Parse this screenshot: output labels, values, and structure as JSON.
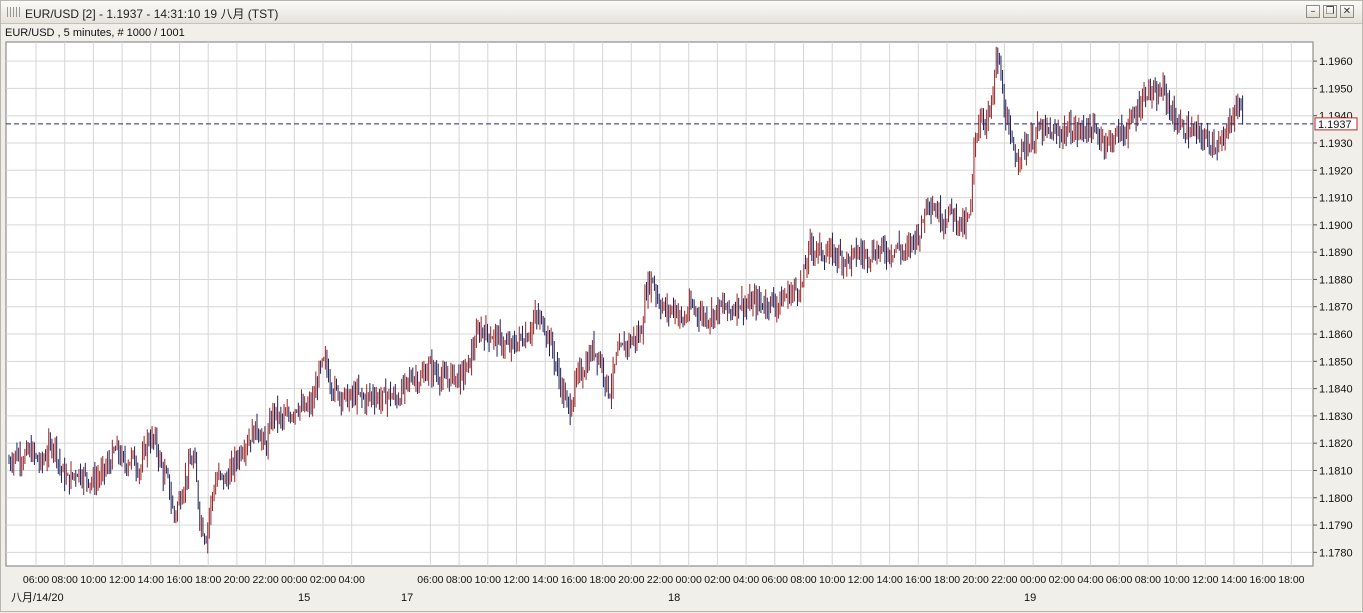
{
  "window": {
    "title": "EUR/USD [2] - 1.1937 - 14:31:10  19 八月 (TST)",
    "subtitle": "EUR/USD , 5 minutes, # 1000 / 1001",
    "buttons": {
      "minimize": "–",
      "restore": "❐",
      "close": "✕"
    }
  },
  "chart_data": {
    "type": "candlestick",
    "symbol": "EUR/USD",
    "timeframe": "5 minutes",
    "current_price": 1.1937,
    "current_price_label": "1.1937",
    "ylim": [
      1.1775,
      1.1967
    ],
    "y_ticks": [
      "1.1960",
      "1.1950",
      "1.1940",
      "1.1930",
      "1.1920",
      "1.1910",
      "1.1900",
      "1.1890",
      "1.1880",
      "1.1870",
      "1.1860",
      "1.1850",
      "1.1840",
      "1.1830",
      "1.1820",
      "1.1810",
      "1.1800",
      "1.1790",
      "1.1780"
    ],
    "x_tick_labels": [
      "06:00",
      "08:00",
      "10:00",
      "12:00",
      "14:00",
      "16:00",
      "18:00",
      "20:00",
      "22:00",
      "00:00",
      "02:00",
      "04:00",
      "06:00",
      "08:00",
      "10:00",
      "12:00",
      "14:00",
      "16:00",
      "18:00",
      "20:00",
      "22:00",
      "00:00",
      "02:00",
      "04:00",
      "06:00",
      "08:00",
      "10:00",
      "12:00",
      "14:00",
      "16:00",
      "18:00",
      "20:00",
      "22:00",
      "00:00",
      "02:00",
      "04:00",
      "06:00",
      "08:00",
      "10:00",
      "12:00",
      "14:00",
      "16:00",
      "18:00"
    ],
    "date_labels": [
      "八月/14/20",
      "15",
      "17",
      "18",
      "19"
    ],
    "price_path": [
      {
        "t": 0,
        "p": 1.1813
      },
      {
        "t": 6,
        "p": 1.1816
      },
      {
        "t": 14,
        "p": 1.1815
      },
      {
        "t": 22,
        "p": 1.1817
      },
      {
        "t": 32,
        "p": 1.1812
      },
      {
        "t": 40,
        "p": 1.1818
      },
      {
        "t": 46,
        "p": 1.182
      },
      {
        "t": 52,
        "p": 1.181
      },
      {
        "t": 60,
        "p": 1.1806
      },
      {
        "t": 68,
        "p": 1.181
      },
      {
        "t": 76,
        "p": 1.1808
      },
      {
        "t": 84,
        "p": 1.1806
      },
      {
        "t": 92,
        "p": 1.1808
      },
      {
        "t": 100,
        "p": 1.1812
      },
      {
        "t": 108,
        "p": 1.1818
      },
      {
        "t": 116,
        "p": 1.1812
      },
      {
        "t": 124,
        "p": 1.1815
      },
      {
        "t": 132,
        "p": 1.181
      },
      {
        "t": 140,
        "p": 1.1822
      },
      {
        "t": 148,
        "p": 1.182
      },
      {
        "t": 154,
        "p": 1.181
      },
      {
        "t": 160,
        "p": 1.1806
      },
      {
        "t": 166,
        "p": 1.1793
      },
      {
        "t": 172,
        "p": 1.18
      },
      {
        "t": 180,
        "p": 1.181
      },
      {
        "t": 186,
        "p": 1.1815
      },
      {
        "t": 192,
        "p": 1.1793
      },
      {
        "t": 198,
        "p": 1.1785
      },
      {
        "t": 204,
        "p": 1.18
      },
      {
        "t": 210,
        "p": 1.1808
      },
      {
        "t": 218,
        "p": 1.1806
      },
      {
        "t": 226,
        "p": 1.1812
      },
      {
        "t": 234,
        "p": 1.1818
      },
      {
        "t": 242,
        "p": 1.1822
      },
      {
        "t": 250,
        "p": 1.1826
      },
      {
        "t": 258,
        "p": 1.1818
      },
      {
        "t": 266,
        "p": 1.1832
      },
      {
        "t": 274,
        "p": 1.1828
      },
      {
        "t": 282,
        "p": 1.183
      },
      {
        "t": 290,
        "p": 1.1834
      },
      {
        "t": 298,
        "p": 1.1832
      },
      {
        "t": 306,
        "p": 1.1835
      },
      {
        "t": 312,
        "p": 1.1846
      },
      {
        "t": 318,
        "p": 1.185
      },
      {
        "t": 326,
        "p": 1.184
      },
      {
        "t": 334,
        "p": 1.1838
      },
      {
        "t": 342,
        "p": 1.1836
      },
      {
        "t": 350,
        "p": 1.1838
      },
      {
        "t": 358,
        "p": 1.1836
      },
      {
        "t": 366,
        "p": 1.1838
      },
      {
        "t": 374,
        "p": 1.1836
      },
      {
        "t": 382,
        "p": 1.1838
      },
      {
        "t": 390,
        "p": 1.1836
      },
      {
        "t": 398,
        "p": 1.184
      },
      {
        "t": 406,
        "p": 1.1845
      },
      {
        "t": 414,
        "p": 1.1843
      },
      {
        "t": 422,
        "p": 1.1848
      },
      {
        "t": 430,
        "p": 1.1846
      },
      {
        "t": 438,
        "p": 1.1843
      },
      {
        "t": 446,
        "p": 1.1845
      },
      {
        "t": 454,
        "p": 1.1844
      },
      {
        "t": 462,
        "p": 1.1848
      },
      {
        "t": 468,
        "p": 1.1856
      },
      {
        "t": 474,
        "p": 1.1862
      },
      {
        "t": 482,
        "p": 1.186
      },
      {
        "t": 490,
        "p": 1.1859
      },
      {
        "t": 498,
        "p": 1.1856
      },
      {
        "t": 506,
        "p": 1.1855
      },
      {
        "t": 514,
        "p": 1.1858
      },
      {
        "t": 522,
        "p": 1.186
      },
      {
        "t": 530,
        "p": 1.1866
      },
      {
        "t": 538,
        "p": 1.1864
      },
      {
        "t": 546,
        "p": 1.1856
      },
      {
        "t": 552,
        "p": 1.1846
      },
      {
        "t": 558,
        "p": 1.1838
      },
      {
        "t": 564,
        "p": 1.1832
      },
      {
        "t": 572,
        "p": 1.1844
      },
      {
        "t": 580,
        "p": 1.1848
      },
      {
        "t": 588,
        "p": 1.1855
      },
      {
        "t": 596,
        "p": 1.185
      },
      {
        "t": 604,
        "p": 1.1838
      },
      {
        "t": 612,
        "p": 1.1852
      },
      {
        "t": 620,
        "p": 1.1856
      },
      {
        "t": 628,
        "p": 1.1858
      },
      {
        "t": 636,
        "p": 1.186
      },
      {
        "t": 642,
        "p": 1.1878
      },
      {
        "t": 648,
        "p": 1.188
      },
      {
        "t": 654,
        "p": 1.1872
      },
      {
        "t": 662,
        "p": 1.1868
      },
      {
        "t": 670,
        "p": 1.187
      },
      {
        "t": 678,
        "p": 1.1864
      },
      {
        "t": 686,
        "p": 1.187
      },
      {
        "t": 694,
        "p": 1.1868
      },
      {
        "t": 702,
        "p": 1.1866
      },
      {
        "t": 710,
        "p": 1.1868
      },
      {
        "t": 718,
        "p": 1.187
      },
      {
        "t": 726,
        "p": 1.1868
      },
      {
        "t": 734,
        "p": 1.1872
      },
      {
        "t": 742,
        "p": 1.187
      },
      {
        "t": 750,
        "p": 1.1872
      },
      {
        "t": 758,
        "p": 1.1871
      },
      {
        "t": 766,
        "p": 1.1872
      },
      {
        "t": 774,
        "p": 1.1871
      },
      {
        "t": 782,
        "p": 1.1874
      },
      {
        "t": 790,
        "p": 1.1876
      },
      {
        "t": 798,
        "p": 1.1878
      },
      {
        "t": 806,
        "p": 1.1892
      },
      {
        "t": 814,
        "p": 1.1891
      },
      {
        "t": 822,
        "p": 1.1889
      },
      {
        "t": 830,
        "p": 1.189
      },
      {
        "t": 838,
        "p": 1.1888
      },
      {
        "t": 846,
        "p": 1.1887
      },
      {
        "t": 854,
        "p": 1.189
      },
      {
        "t": 862,
        "p": 1.1889
      },
      {
        "t": 870,
        "p": 1.189
      },
      {
        "t": 878,
        "p": 1.1891
      },
      {
        "t": 886,
        "p": 1.189
      },
      {
        "t": 894,
        "p": 1.1892
      },
      {
        "t": 902,
        "p": 1.1889
      },
      {
        "t": 910,
        "p": 1.1895
      },
      {
        "t": 918,
        "p": 1.1898
      },
      {
        "t": 924,
        "p": 1.191
      },
      {
        "t": 932,
        "p": 1.1906
      },
      {
        "t": 940,
        "p": 1.1902
      },
      {
        "t": 948,
        "p": 1.1905
      },
      {
        "t": 956,
        "p": 1.1901
      },
      {
        "t": 962,
        "p": 1.1899
      },
      {
        "t": 968,
        "p": 1.1905
      },
      {
        "t": 972,
        "p": 1.1932
      },
      {
        "t": 978,
        "p": 1.194
      },
      {
        "t": 984,
        "p": 1.1938
      },
      {
        "t": 990,
        "p": 1.1945
      },
      {
        "t": 994,
        "p": 1.1963
      },
      {
        "t": 998,
        "p": 1.1955
      },
      {
        "t": 1002,
        "p": 1.1942
      },
      {
        "t": 1008,
        "p": 1.193
      },
      {
        "t": 1014,
        "p": 1.1925
      },
      {
        "t": 1020,
        "p": 1.1928
      },
      {
        "t": 1028,
        "p": 1.193
      },
      {
        "t": 1036,
        "p": 1.1935
      },
      {
        "t": 1044,
        "p": 1.1934
      },
      {
        "t": 1052,
        "p": 1.1933
      },
      {
        "t": 1060,
        "p": 1.1934
      },
      {
        "t": 1068,
        "p": 1.1935
      },
      {
        "t": 1076,
        "p": 1.1934
      },
      {
        "t": 1084,
        "p": 1.1936
      },
      {
        "t": 1092,
        "p": 1.1934
      },
      {
        "t": 1100,
        "p": 1.1932
      },
      {
        "t": 1106,
        "p": 1.193
      },
      {
        "t": 1114,
        "p": 1.1933
      },
      {
        "t": 1122,
        "p": 1.1934
      },
      {
        "t": 1130,
        "p": 1.1938
      },
      {
        "t": 1138,
        "p": 1.1944
      },
      {
        "t": 1146,
        "p": 1.195
      },
      {
        "t": 1154,
        "p": 1.1946
      },
      {
        "t": 1162,
        "p": 1.195
      },
      {
        "t": 1168,
        "p": 1.1943
      },
      {
        "t": 1174,
        "p": 1.1938
      },
      {
        "t": 1182,
        "p": 1.1935
      },
      {
        "t": 1190,
        "p": 1.1934
      },
      {
        "t": 1198,
        "p": 1.1933
      },
      {
        "t": 1206,
        "p": 1.1931
      },
      {
        "t": 1214,
        "p": 1.193
      },
      {
        "t": 1222,
        "p": 1.1929
      },
      {
        "t": 1228,
        "p": 1.1938
      },
      {
        "t": 1234,
        "p": 1.1942
      },
      {
        "t": 1240,
        "p": 1.1945
      },
      {
        "t": 1243,
        "p": 1.1937
      }
    ],
    "colors": {
      "up": "#9a2222",
      "down": "#20205a",
      "grid": "#d6d6d6",
      "price_line": "#2a2a72",
      "price_box": "#cc2222",
      "background": "#ffffff",
      "frame": "#7a7a7a"
    },
    "grid": true
  }
}
